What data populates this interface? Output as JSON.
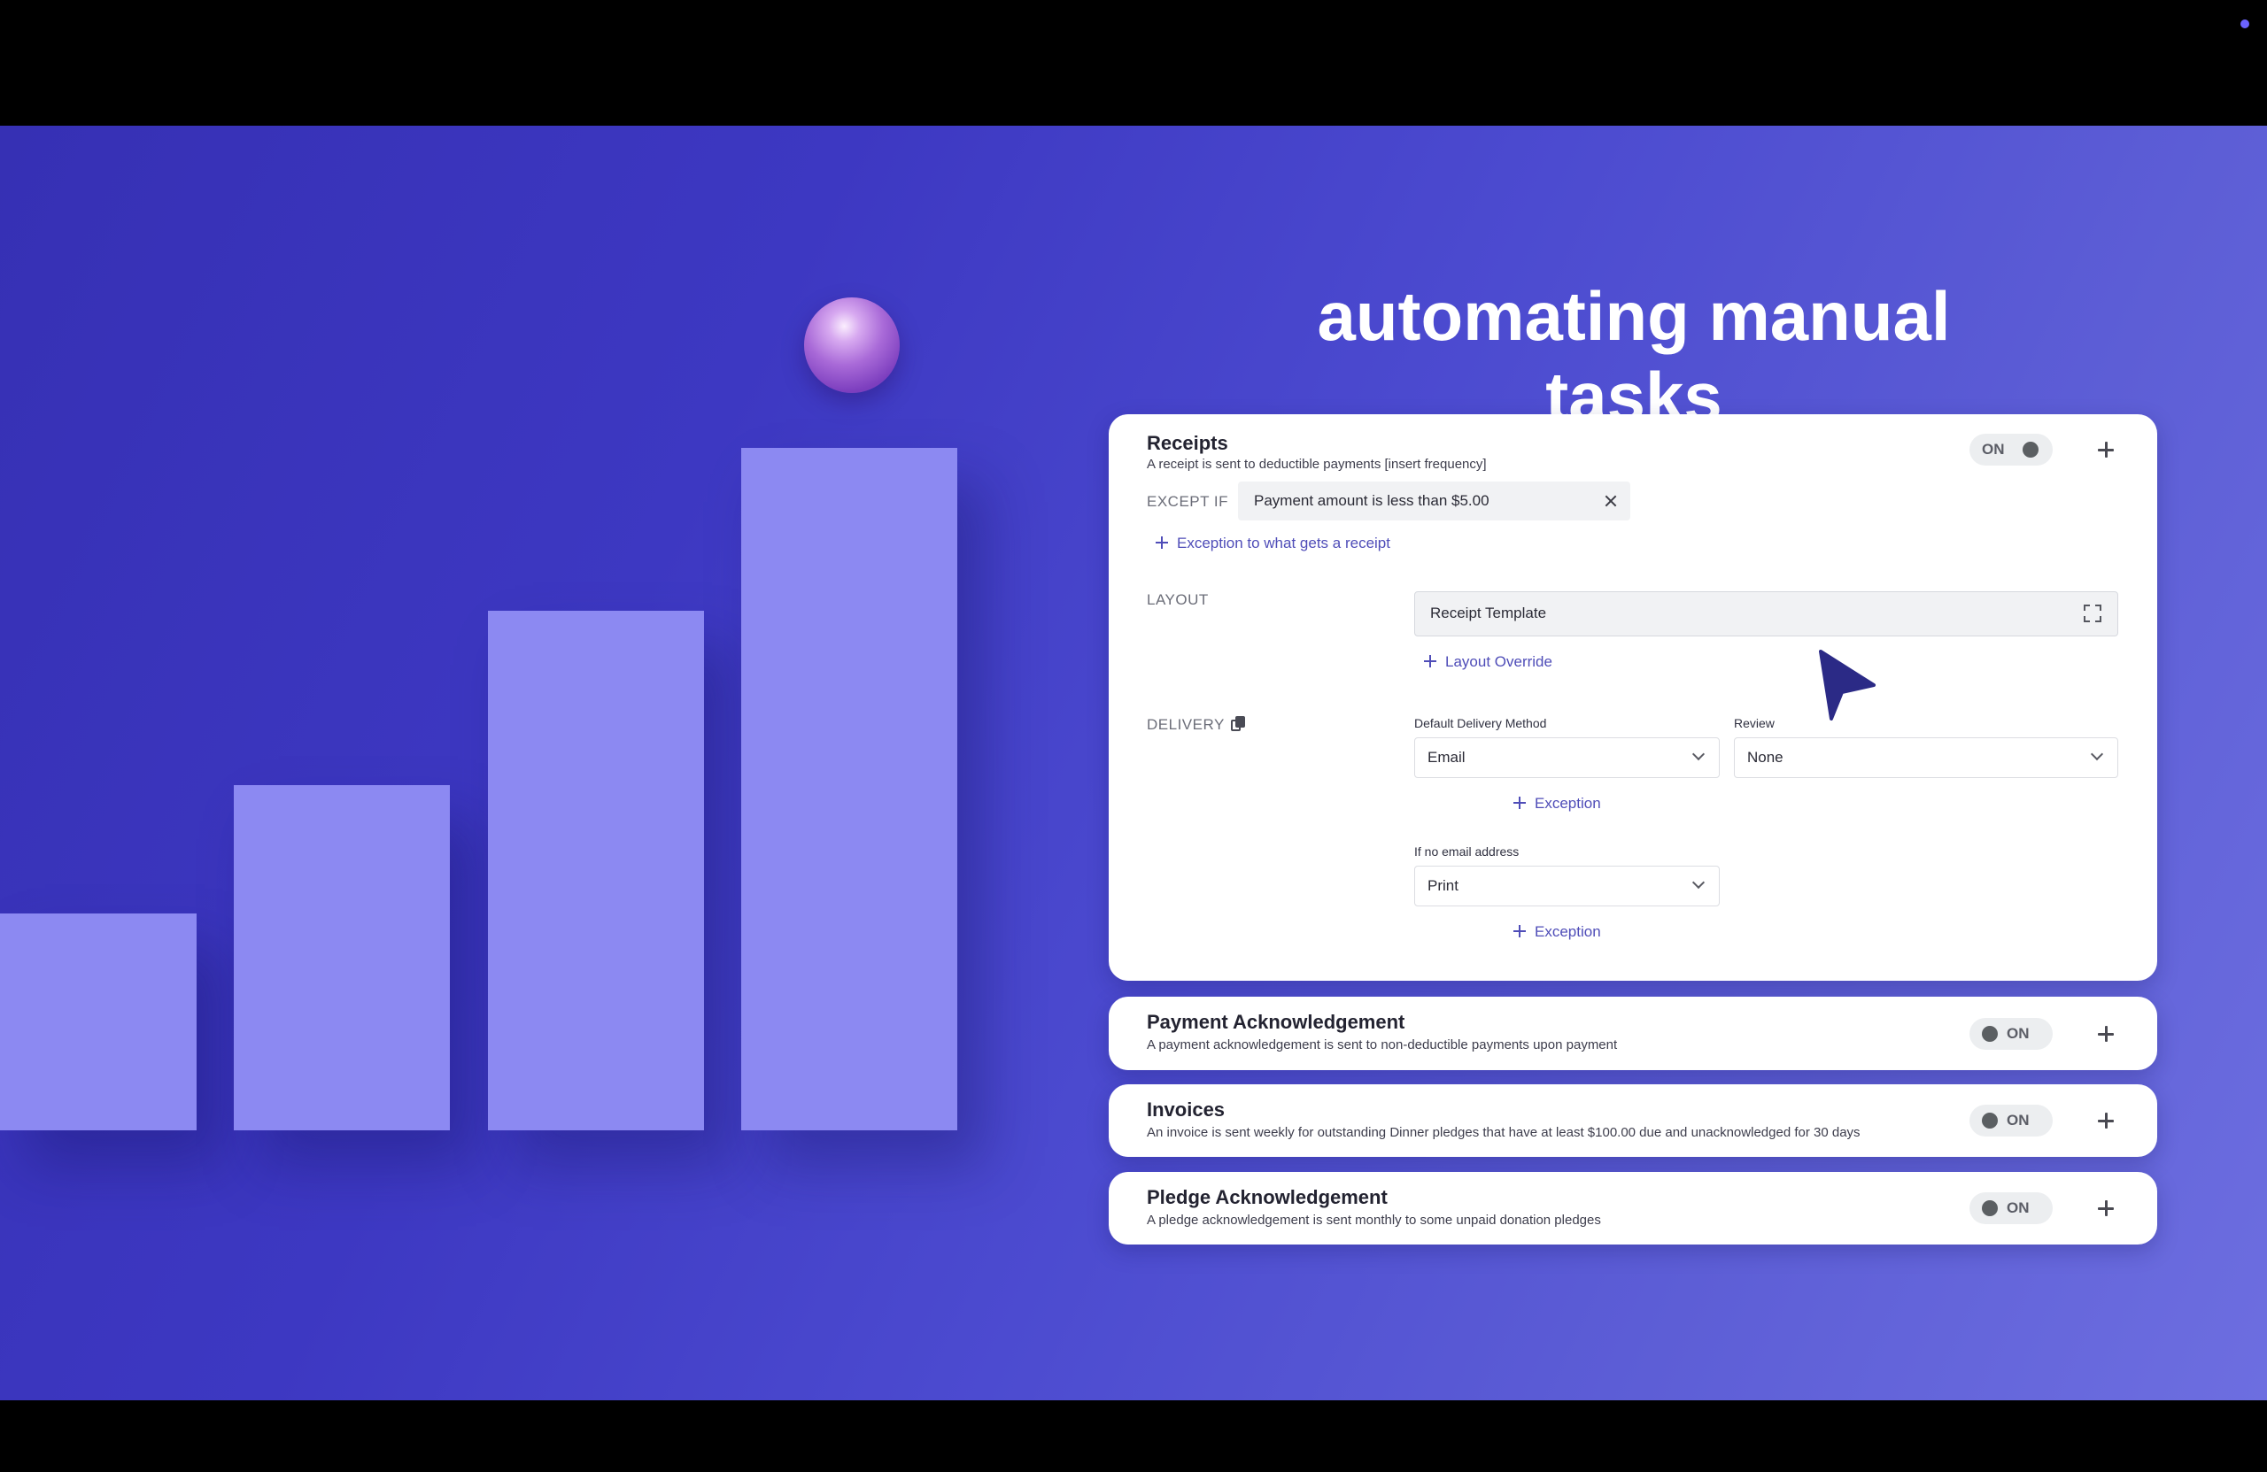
{
  "headline": "automating manual tasks",
  "receipts": {
    "title": "Receipts",
    "description": "A receipt is sent to deductible payments [insert frequency]",
    "toggle": "ON",
    "except_label": "EXCEPT IF",
    "except_value": "Payment amount is less than $5.00",
    "add_exception_link": "Exception to what gets a receipt",
    "layout_label": "LAYOUT",
    "layout_value": "Receipt Template",
    "layout_override_link": "Layout Override",
    "delivery_label": "DELIVERY",
    "default_delivery_caption": "Default Delivery Method",
    "default_delivery_value": "Email",
    "review_caption": "Review",
    "review_value": "None",
    "exception_link_1": "Exception",
    "no_email_caption": "If no email address",
    "no_email_value": "Print",
    "exception_link_2": "Exception"
  },
  "collapsed_cards": [
    {
      "title": "Payment Acknowledgement",
      "description": "A payment acknowledgement is sent to non-deductible payments upon payment",
      "toggle": "ON"
    },
    {
      "title": "Invoices",
      "description": "An invoice is sent weekly for outstanding Dinner pledges that have at least $100.00 due and unacknowledged for 30 days",
      "toggle": "ON"
    },
    {
      "title": "Pledge Acknowledgement",
      "description": "A pledge acknowledgement is sent monthly to some unpaid donation pledges",
      "toggle": "ON"
    }
  ],
  "colors": {
    "background": "#3d38c2",
    "bars": "#8c89f2",
    "link": "#4f4db8",
    "cursor": "#2b2a86"
  },
  "icons": [
    "plus-icon",
    "close-icon",
    "expand-icon",
    "copy-icon",
    "chevron-down-icon",
    "cursor-arrow-icon"
  ]
}
